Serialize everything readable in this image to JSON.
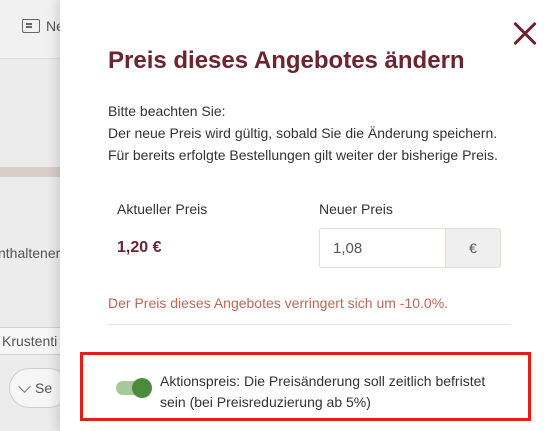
{
  "background": {
    "tab_news": "Ne",
    "text_contained": "nthaltener",
    "text_crustacean": "Krustenti",
    "button_label": "Se"
  },
  "modal": {
    "title": "Preis dieses Angebotes ändern",
    "notice_lines": [
      "Bitte beachten Sie:",
      "Der neue Preis wird gültig, sobald Sie die Änderung speichern.",
      "Für bereits erfolgte Bestellungen gilt weiter der bisherige Preis."
    ],
    "current_price_label": "Aktueller Preis",
    "current_price_value": "1,20 €",
    "new_price_label": "Neuer Preis",
    "new_price_value": "1,08",
    "currency_symbol": "€",
    "change_message": "Der Preis dieses Angebotes verringert sich um -10.0%.",
    "promo_toggle": {
      "enabled": true,
      "label": "Aktionspreis: Die Preisänderung soll zeitlich befristet sein (bei Preisreduzierung ab 5%)"
    }
  },
  "colors": {
    "accent": "#6b2430",
    "change_text": "#b86a5a",
    "toggle_on": "#4e8a3b",
    "highlight_border": "#e0201c"
  },
  "icons": {
    "news": "newspaper-icon",
    "close": "close-icon",
    "dropdown": "chevron-down-icon"
  }
}
